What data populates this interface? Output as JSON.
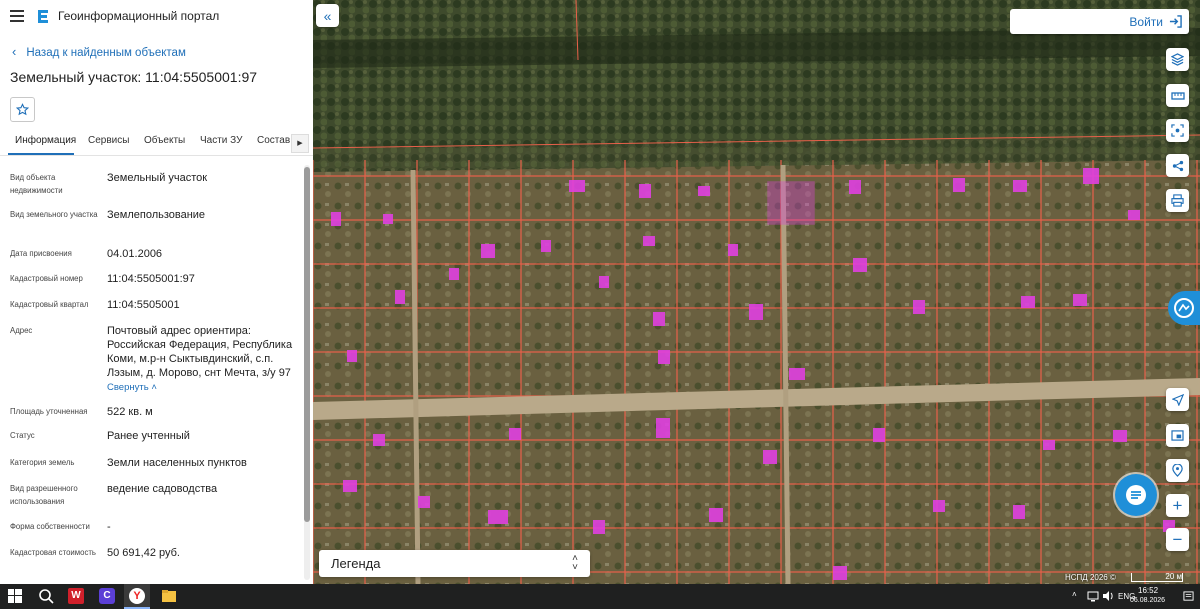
{
  "header": {
    "title": "Геоинформационный портал",
    "menu_icon": "hamburger-icon",
    "logo_icon": "portal-logo-icon"
  },
  "back_link": "Назад к найденным объектам",
  "object_title": "Земельный участок: 11:04:5505001:97",
  "tabs": [
    {
      "label": "Информация",
      "active": true
    },
    {
      "label": "Сервисы"
    },
    {
      "label": "Объекты"
    },
    {
      "label": "Части ЗУ"
    },
    {
      "label": "Состав"
    }
  ],
  "properties": [
    {
      "key": "Вид объекта недвижимости",
      "value": "Земельный участок"
    },
    {
      "key": "Вид земельного участка",
      "value": "Землепользование"
    },
    {
      "key": "Дата присвоения",
      "value": "04.01.2006"
    },
    {
      "key": "Кадастровый номер",
      "value": "11:04:5505001:97"
    },
    {
      "key": "Кадастровый квартал",
      "value": "11:04:5505001"
    },
    {
      "key": "Адрес",
      "value": "Почтовый адрес ориентира: Российская Федерация, Республика Коми, м.р-н Сыктывдинский, с.п. Лэзым, д. Морово, снт Мечта, з/у 97"
    },
    {
      "key": "Площадь уточненная",
      "value": "522 кв. м"
    },
    {
      "key": "Статус",
      "value": "Ранее учтенный"
    },
    {
      "key": "Категория земель",
      "value": "Земли населенных пунктов"
    },
    {
      "key": "Вид разрешенного использования",
      "value": "ведение садоводства"
    },
    {
      "key": "Форма собственности",
      "value": "-"
    },
    {
      "key": "Кадастровая стоимость",
      "value": "50 691,42 руб."
    }
  ],
  "collapse_label": "Свернуть",
  "map": {
    "login_label": "Войти",
    "legend_label": "Легенда",
    "attribution": "НСПД 2026 ©",
    "scale_label": "20 м",
    "accent_color": "#1f6fb8",
    "parcel_border_color": "#e8604a",
    "building_color": "#e040e0"
  },
  "taskbar": {
    "lang": "ENG",
    "time": "16:52",
    "date": "06.08.2026"
  }
}
